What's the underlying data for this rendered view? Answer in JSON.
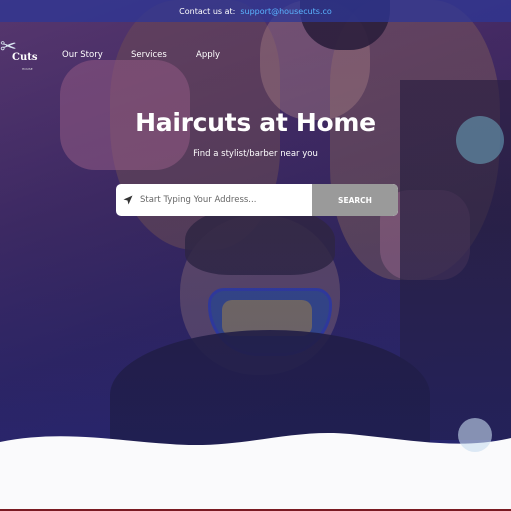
{
  "topbar": {
    "label": "Contact us at:",
    "email": "support@housecuts.co"
  },
  "logo": {
    "brand": "Cuts",
    "sub": "HOUSE"
  },
  "nav": {
    "items": [
      "Our Story",
      "Services",
      "Apply"
    ]
  },
  "hero": {
    "title": "Haircuts at Home",
    "subtitle": "Find a stylist/barber near you"
  },
  "search": {
    "placeholder": "Start Typing Your Address...",
    "button": "SEARCH"
  },
  "icons": {
    "location": "location-arrow-icon",
    "logo": "scissors-icon"
  },
  "colors": {
    "topbar": "#2d3796",
    "email": "#5ab4ff",
    "search_button": "#9a9a9a",
    "accent_line": "#7a1a22"
  }
}
